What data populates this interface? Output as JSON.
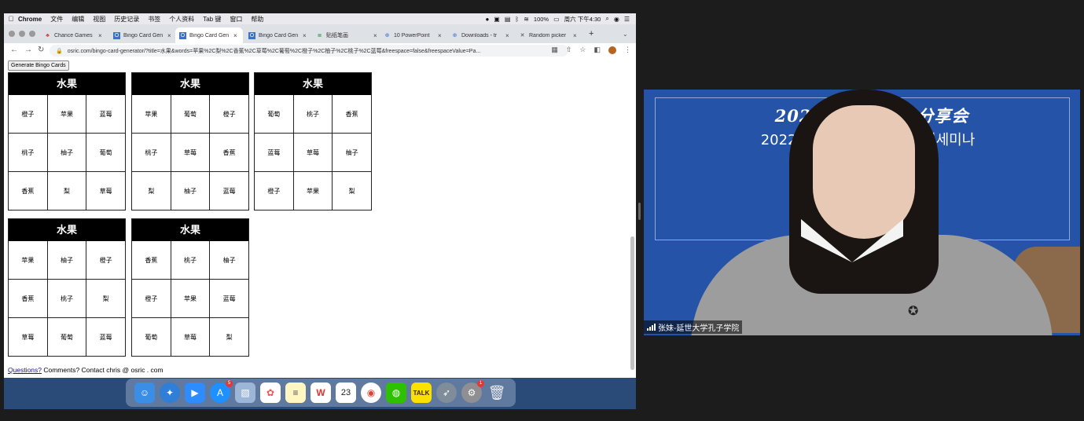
{
  "menubar": {
    "items": [
      "Chrome",
      "文件",
      "编辑",
      "视图",
      "历史记录",
      "书签",
      "个人资料",
      "Tab 键",
      "窗口",
      "帮助"
    ],
    "battery": "100%",
    "datetime": "周六 下午4:30"
  },
  "tabs": [
    {
      "label": "Chance Games",
      "icon": "game-icon"
    },
    {
      "label": "Bingo Card Gen",
      "icon": "osric-icon"
    },
    {
      "label": "Bingo Card Gen",
      "icon": "osric-icon",
      "active": true
    },
    {
      "label": "Bingo Card Gen",
      "icon": "osric-icon"
    },
    {
      "label": "贴纸笔画",
      "icon": "sticker-icon"
    },
    {
      "label": "10 PowerPoint",
      "icon": "web-icon"
    },
    {
      "label": "Downloads - tr",
      "icon": "web-icon"
    },
    {
      "label": "Random picker",
      "icon": "picker-icon"
    }
  ],
  "address": {
    "url": "osric.com/bingo-card-generator/?title=水果&words=苹果%2C梨%2C香蕉%2C草莓%2C葡萄%2C橙子%2C柚子%2C桃子%2C蓝莓&freespace=false&freespaceValue=Pa..."
  },
  "page": {
    "generate_button": "Generate Bingo Cards",
    "cards": [
      {
        "title": "水果",
        "cells": [
          [
            "橙子",
            "苹果",
            "蓝莓"
          ],
          [
            "桃子",
            "柚子",
            "葡萄"
          ],
          [
            "香蕉",
            "梨",
            "草莓"
          ]
        ]
      },
      {
        "title": "水果",
        "cells": [
          [
            "苹果",
            "葡萄",
            "橙子"
          ],
          [
            "桃子",
            "草莓",
            "香蕉"
          ],
          [
            "梨",
            "柚子",
            "蓝莓"
          ]
        ]
      },
      {
        "title": "水果",
        "cells": [
          [
            "葡萄",
            "桃子",
            "香蕉"
          ],
          [
            "蓝莓",
            "草莓",
            "柚子"
          ],
          [
            "橙子",
            "苹果",
            "梨"
          ]
        ]
      },
      {
        "title": "水果",
        "cells": [
          [
            "苹果",
            "柚子",
            "橙子"
          ],
          [
            "香蕉",
            "桃子",
            "梨"
          ],
          [
            "草莓",
            "葡萄",
            "蓝莓"
          ]
        ]
      },
      {
        "title": "水果",
        "cells": [
          [
            "香蕉",
            "桃子",
            "柚子"
          ],
          [
            "橙子",
            "苹果",
            "蓝莓"
          ],
          [
            "葡萄",
            "草莓",
            "梨"
          ]
        ]
      }
    ],
    "footer_link": "Questions?",
    "footer_text": " Comments? Contact chris @ osric . com"
  },
  "dock": {
    "items": [
      "finder-icon",
      "safari-icon",
      "zoom-icon",
      "appstore-icon",
      "preview-icon",
      "photos-icon",
      "notes-icon",
      "wps-icon",
      "calendar-icon",
      "chrome-icon",
      "wechat-icon",
      "kakaotalk-icon",
      "launchpad-icon",
      "settings-icon",
      "trash-icon"
    ],
    "calendar_day": "23",
    "appstore_badge": "5",
    "settings_badge": "1"
  },
  "video": {
    "banner_line1": "2022年孔    学经验分享会",
    "banner_line2": "2022공자아카데        교수법 양성세미나",
    "participant_name": "张妹-延世大学孔子学院"
  }
}
